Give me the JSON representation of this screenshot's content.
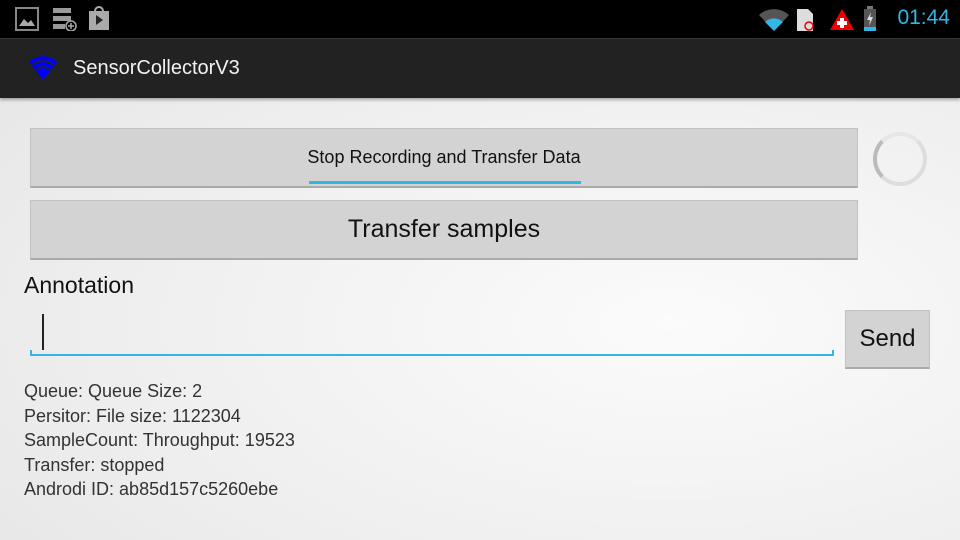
{
  "status_bar": {
    "time": "01:44",
    "icons": [
      "gallery-icon",
      "storage-add-icon",
      "play-store-icon",
      "wifi-icon",
      "sd-card-blocked-icon",
      "warning-cross-icon",
      "battery-charging-icon"
    ],
    "accent": "#33b5e5"
  },
  "app_bar": {
    "title": "SensorCollectorV3",
    "icon": "wifi-icon",
    "icon_color": "#0000ff"
  },
  "main": {
    "stop_button": "Stop Recording and Transfer Data",
    "transfer_button": "Transfer samples",
    "annotation_label": "Annotation",
    "annotation_value": "",
    "send_button": "Send",
    "info": [
      "Queue: Queue Size: 2",
      "Persitor: File size: 1122304",
      "SampleCount: Throughput: 19523",
      "Transfer: stopped",
      "Androdi ID: ab85d157c5260ebe"
    ]
  }
}
